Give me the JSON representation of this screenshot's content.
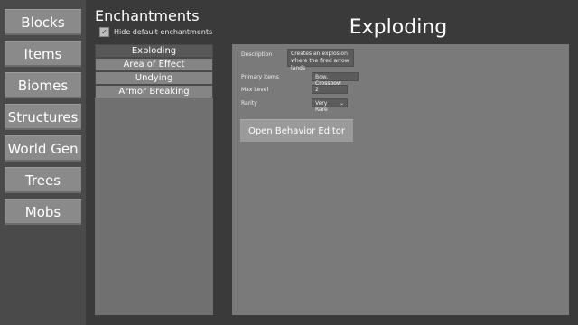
{
  "nav": {
    "items": [
      {
        "label": "Blocks"
      },
      {
        "label": "Items"
      },
      {
        "label": "Biomes"
      },
      {
        "label": "Structures"
      },
      {
        "label": "World Gen"
      },
      {
        "label": "Trees"
      },
      {
        "label": "Mobs"
      }
    ]
  },
  "section": {
    "heading": "Enchantments",
    "hide_default_label": "Hide default enchantments",
    "hide_default_checked": true,
    "check_glyph": "✓"
  },
  "list": {
    "items": [
      {
        "label": "Exploding",
        "selected": true
      },
      {
        "label": "Area of Effect",
        "selected": false
      },
      {
        "label": "Undying",
        "selected": false
      },
      {
        "label": "Armor Breaking",
        "selected": false
      }
    ]
  },
  "detail": {
    "title": "Exploding",
    "description_label": "Description",
    "description_value": "Creates an explosion where the fired arrow lands",
    "primary_items_label": "Primary Items",
    "primary_items_value": "Bow, Crossbow",
    "max_level_label": "Max Level",
    "max_level_value": "2",
    "rarity_label": "Rarity",
    "rarity_value": "Very Rare",
    "rarity_dropdown_glyph": "⌄",
    "open_editor_label": "Open Behavior Editor"
  }
}
